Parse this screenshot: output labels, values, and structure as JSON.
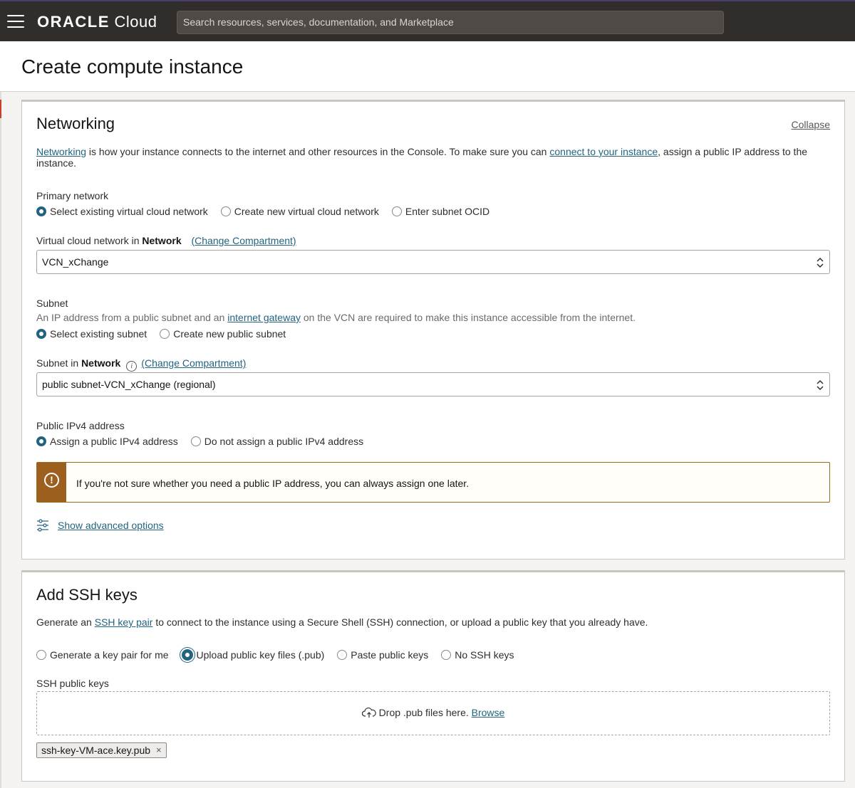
{
  "topbar": {
    "brand_bold": "ORACLE",
    "brand_light": "Cloud",
    "search_placeholder": "Search resources, services, documentation, and Marketplace",
    "menu_icon": "hamburger-icon"
  },
  "page": {
    "title": "Create compute instance"
  },
  "networking": {
    "title": "Networking",
    "collapse": "Collapse",
    "intro_link1": "Networking",
    "intro_text1": " is how your instance connects to the internet and other resources in the Console. To make sure you can ",
    "intro_link2": "connect to your instance",
    "intro_text2": ", assign a public IP address to the instance.",
    "primary_network": {
      "label": "Primary network",
      "options": [
        "Select existing virtual cloud network",
        "Create new virtual cloud network",
        "Enter subnet OCID"
      ],
      "selected": 0
    },
    "vcn": {
      "label_prefix": "Virtual cloud network in ",
      "label_bold": "Network",
      "change_link": "(Change Compartment)",
      "value": "VCN_xChange"
    },
    "subnet": {
      "label": "Subnet",
      "desc_text1": "An IP address from a public subnet and an ",
      "desc_link": "internet gateway",
      "desc_text2": " on the VCN are required to make this instance accessible from the internet.",
      "options": [
        "Select existing subnet",
        "Create new public subnet"
      ],
      "selected": 0
    },
    "subnet_select": {
      "label_prefix": "Subnet in ",
      "label_bold": "Network",
      "info_icon": "i",
      "change_link": "(Change Compartment)",
      "value": "public subnet-VCN_xChange (regional)"
    },
    "ipv4": {
      "label": "Public IPv4 address",
      "options": [
        "Assign a public IPv4 address",
        "Do not assign a public IPv4 address"
      ],
      "selected": 0
    },
    "warning": {
      "icon": "!",
      "text": "If you're not sure whether you need a public IP address, you can always assign one later."
    },
    "advanced": "Show advanced options"
  },
  "ssh": {
    "title": "Add SSH keys",
    "intro_text1": "Generate an ",
    "intro_link": "SSH key pair",
    "intro_text2": " to connect to the instance using a Secure Shell (SSH) connection, or upload a public key that you already have.",
    "options": [
      "Generate a key pair for me",
      "Upload public key files (.pub)",
      "Paste public keys",
      "No SSH keys"
    ],
    "selected": 1,
    "keys_label": "SSH public keys",
    "drop_text": "Drop .pub files here. ",
    "browse": "Browse",
    "file_chip": "ssh-key-VM-ace.key.pub",
    "chip_remove": "×"
  }
}
